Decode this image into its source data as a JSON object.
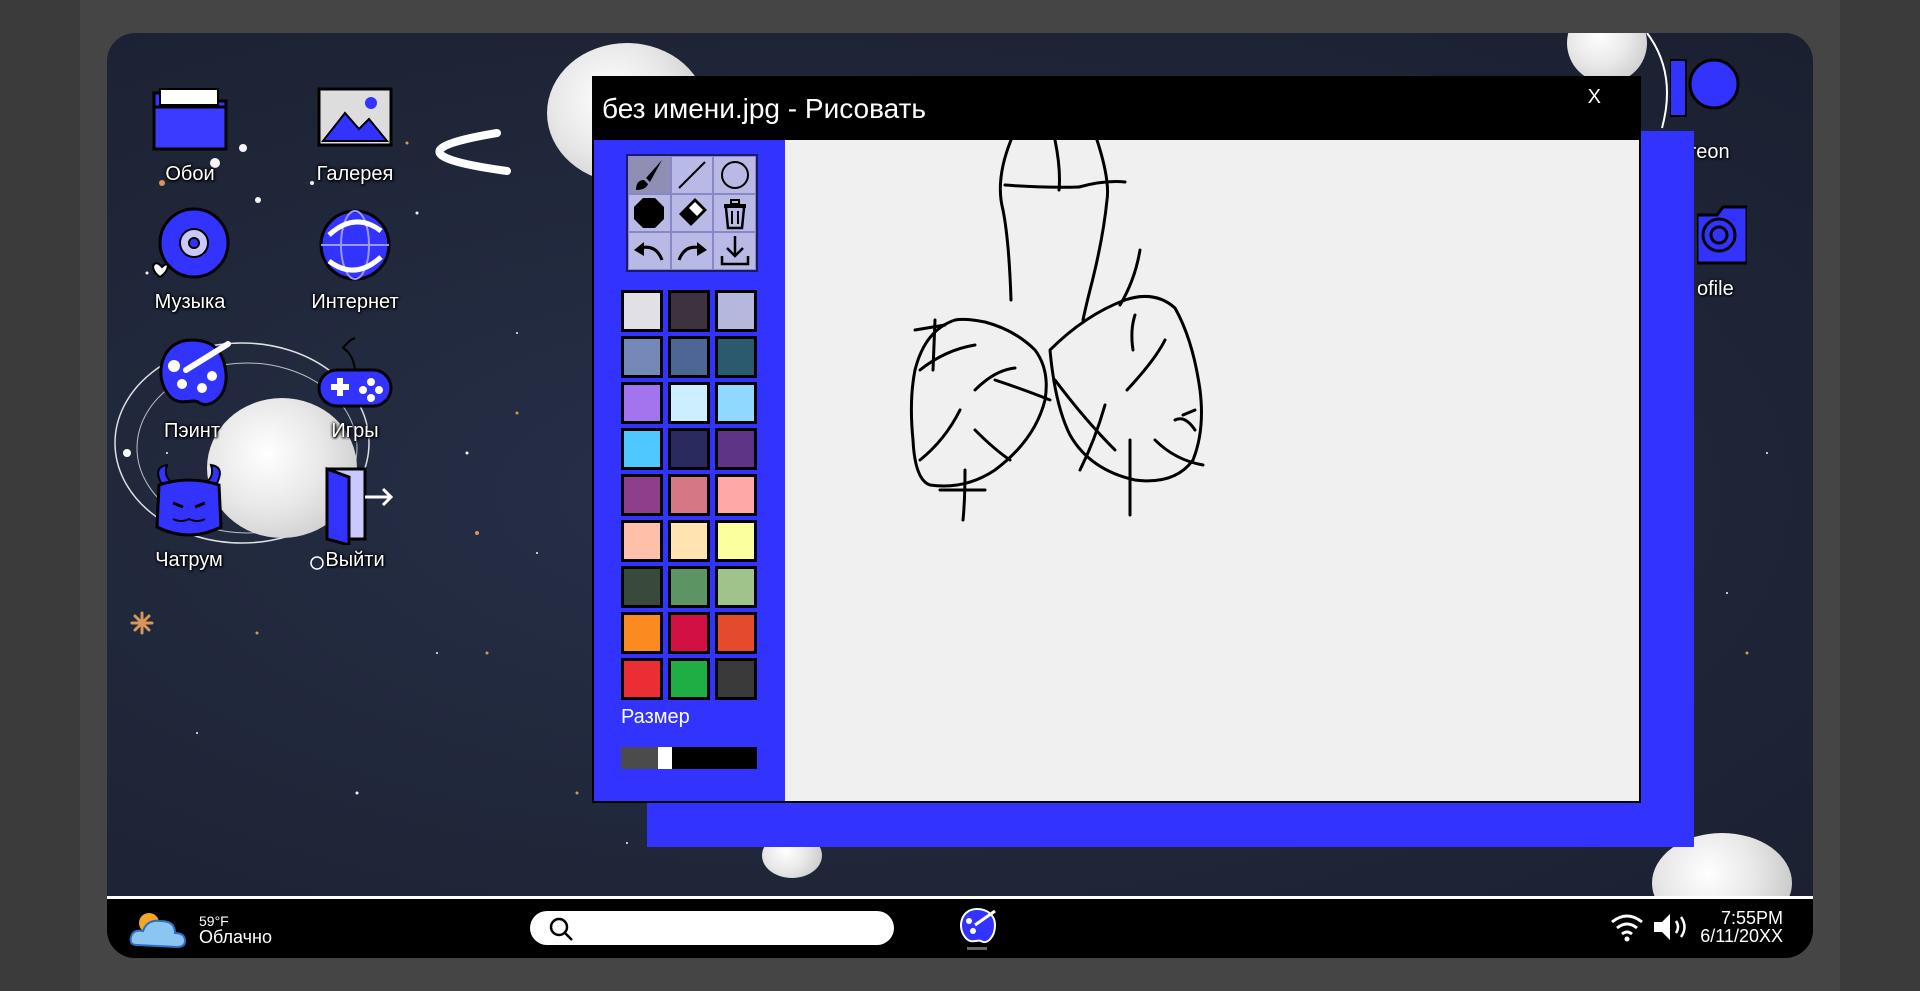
{
  "desktop": {
    "icons": [
      {
        "label": "Обои",
        "icon": "folder-icon"
      },
      {
        "label": "Галерея",
        "icon": "gallery-icon"
      },
      {
        "label": "Музыка",
        "icon": "music-disc-icon"
      },
      {
        "label": "Интернет",
        "icon": "globe-icon"
      },
      {
        "label": "Пэинт",
        "icon": "paint-palette-icon"
      },
      {
        "label": "Игры",
        "icon": "gamepad-icon"
      },
      {
        "label": "Чатрум",
        "icon": "devil-chat-icon"
      },
      {
        "label": "Выйти",
        "icon": "exit-door-icon"
      }
    ],
    "partial_labels": [
      "treon",
      "ofile"
    ]
  },
  "paint": {
    "title": "без имени.jpg - Рисовать",
    "close_label": "X",
    "tools": [
      "brush-icon",
      "line-icon",
      "circle-icon",
      "fill-shape-icon",
      "eraser-icon",
      "trash-icon",
      "undo-icon",
      "redo-icon",
      "download-icon"
    ],
    "active_tool": "brush-icon",
    "colors": [
      "#e0e0e6",
      "#3d3340",
      "#b4b8dc",
      "#7489b7",
      "#4d6694",
      "#2b5a6e",
      "#a275ef",
      "#cdeeff",
      "#8fd8ff",
      "#4fc7ff",
      "#2b2a5e",
      "#5e3487",
      "#8e3e8a",
      "#d57784",
      "#ffa8a8",
      "#ffbfa8",
      "#ffe3b0",
      "#fbff9d",
      "#39493b",
      "#5d9463",
      "#9fc48b",
      "#fb8a20",
      "#d21043",
      "#e44b2c",
      "#ea2e34",
      "#1fae43",
      "#3a3a3a"
    ],
    "size_label": "Размер",
    "size_value": 0.3
  },
  "taskbar": {
    "temperature": "59°F",
    "condition": "Облачно",
    "search_value": "",
    "time": "7:55PM",
    "date": "6/11/20XX"
  }
}
